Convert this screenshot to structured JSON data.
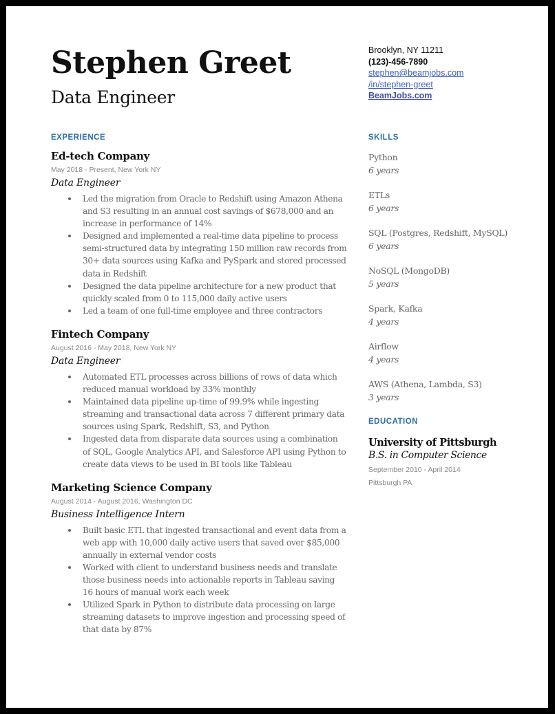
{
  "header": {
    "name": "Stephen Greet",
    "title": "Data Engineer"
  },
  "contact": {
    "location": "Brooklyn, NY 11211",
    "phone": "(123)-456-7890",
    "email": "stephen@beamjobs.com",
    "linkedin": "/in/stephen-greet",
    "website": "BeamJobs.com"
  },
  "colors": {
    "section_heading": "#2f6ea8",
    "link": "#3a5bbf",
    "border": "#000000"
  },
  "experience": {
    "label": "EXPERIENCE",
    "jobs": [
      {
        "company": "Ed-tech Company",
        "meta": "May 2018 - Present, New York NY",
        "role": "Data Engineer",
        "bullets": [
          "Led the migration from Oracle to Redshift using Amazon Athena and S3 resulting in an annual cost savings of $678,000 and an increase in performance of 14%",
          "Designed and implemented a real-time data pipeline to process semi-structured data by integrating 150 million raw records from 30+ data sources using Kafka and PySpark and stored processed data in Redshift",
          "Designed the data pipeline architecture for a new product that quickly scaled from 0 to 115,000 daily active users",
          "Led a team of one full-time employee and three contractors"
        ]
      },
      {
        "company": "Fintech Company",
        "meta": "August 2016 - May 2018, New York NY",
        "role": "Data Engineer",
        "bullets": [
          "Automated ETL processes across billions of rows of data which reduced manual workload by 33% monthly",
          "Maintained data pipeline up-time of 99.9% while ingesting streaming and transactional data across 7 different primary data sources using Spark, Redshift, S3, and Python",
          "Ingested data from disparate data sources using a combination of SQL, Google Analytics API, and Salesforce API using Python to create data views to be used in BI tools like Tableau"
        ]
      },
      {
        "company": "Marketing Science Company",
        "meta": "August 2014 - August 2016, Washington DC",
        "role": "Business Intelligence Intern",
        "bullets": [
          "Built basic ETL that ingested transactional and event data from a web app with 10,000 daily active users that saved over $85,000 annually in external vendor costs",
          "Worked with client to understand business needs and translate those business needs into actionable reports in Tableau saving 16 hours of manual work each week",
          "Utilized Spark in Python to distribute data processing on large streaming datasets to improve ingestion and processing speed of that data by 87%"
        ]
      }
    ]
  },
  "skills": {
    "label": "SKILLS",
    "items": [
      {
        "name": "Python",
        "years": "6 years"
      },
      {
        "name": "ETLs",
        "years": "6 years"
      },
      {
        "name": "SQL (Postgres, Redshift, MySQL)",
        "years": "6 years"
      },
      {
        "name": "NoSQL (MongoDB)",
        "years": "5 years"
      },
      {
        "name": "Spark, Kafka",
        "years": "4 years"
      },
      {
        "name": "Airflow",
        "years": "4 years"
      },
      {
        "name": "AWS (Athena, Lambda, S3)",
        "years": "3 years"
      }
    ]
  },
  "education": {
    "label": "EDUCATION",
    "school": "University of Pittsburgh",
    "degree": "B.S. in Computer Science",
    "dates": "September 2010 - April 2014",
    "location": "Pittsburgh PA"
  }
}
